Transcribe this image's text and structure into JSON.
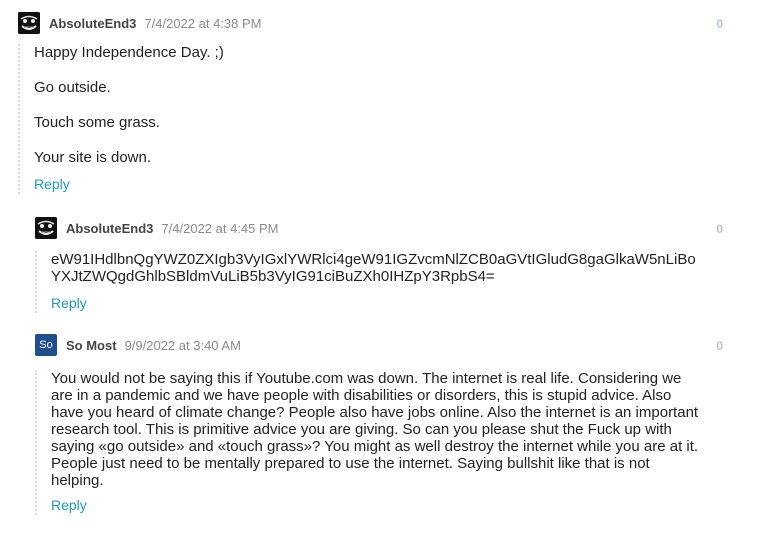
{
  "comments": [
    {
      "author": "AbsoluteEnd3",
      "date": "7/4/2022 at 4:38 PM",
      "votes": "0",
      "avatar_icon": "troll-face-icon",
      "paragraphs": [
        "Happy Independence Day. ;)",
        "Go outside.",
        "Touch some grass.",
        "Your site is down."
      ],
      "reply_label": "Reply"
    },
    {
      "author": "AbsoluteEnd3",
      "date": "7/4/2022 at 4:45 PM",
      "votes": "0",
      "avatar_icon": "troll-face-icon",
      "lines": [
        "eW91IHdlbnQgYWZ0ZXIgb3VyIGxlYWRlci4geW91IGZvcmNlZCB0aGVtIGludG8gaGlkaW5nLiBo",
        "YXJtZWQgdGhlbSBldmVuLiB5b3VyIG91ciBuZXh0IHZpY3RpbS4="
      ],
      "reply_label": "Reply"
    },
    {
      "author": "So Most",
      "date": "9/9/2022 at 3:40 AM",
      "votes": "0",
      "avatar_text": "So",
      "lines": [
        "You would not be saying this if Youtube.com was down. The internet is real life. Considering we",
        "are in a pandemic and we have people with disabilities or disorders, this is stupid advice. Also",
        "have you heard of climate change? People also have jobs online. Also the internet is an important",
        "research tool. This is primitive advice you are giving. So can you please shut the Fuck up with",
        "saying «go outside» and «touch grass»? You might as well destroy the internet while you are at it.",
        "People just need to be mentally prepared to use the internet. Saying bullshit like that is not",
        "helping."
      ],
      "reply_label": "Reply"
    }
  ]
}
